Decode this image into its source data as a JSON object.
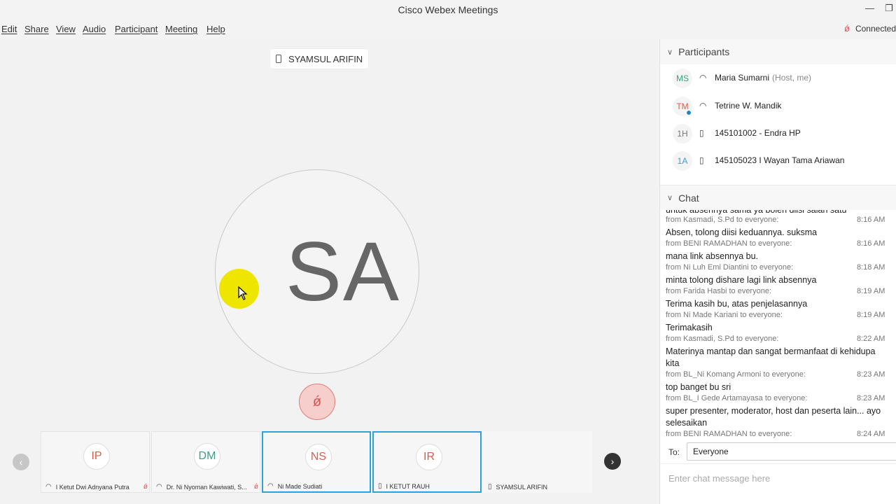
{
  "window": {
    "title": "Cisco Webex Meetings",
    "minimize_glyph": "—",
    "maximize_glyph": "❐"
  },
  "menu": [
    {
      "label": "Edit"
    },
    {
      "label": "Share"
    },
    {
      "label": "View"
    },
    {
      "label": "Audio"
    },
    {
      "label": "Participant"
    },
    {
      "label": "Meeting"
    },
    {
      "label": "Help"
    }
  ],
  "status": {
    "text": "Connected",
    "icon": "muted-mic-icon"
  },
  "stage": {
    "active_speaker": "SYAMSUL ARIFIN",
    "avatar_initials": "SA",
    "mute_icon": "muted-mic-icon"
  },
  "thumbnails": [
    {
      "initials": "IP",
      "color": "#e05a47",
      "name": "I Ketut Dwi Adnyana Putra",
      "icon": "headset-icon",
      "muted": true,
      "active": false
    },
    {
      "initials": "DM",
      "color": "#3aa27e",
      "name": "Dr. Ni Nyoman Kawiwati, S...",
      "icon": "headset-icon",
      "muted": true,
      "active": false
    },
    {
      "initials": "NS",
      "color": "#e05a47",
      "name": "Ni Made Sudiati",
      "icon": "headset-icon",
      "muted": false,
      "active": true
    },
    {
      "initials": "IR",
      "color": "#e05a47",
      "name": "I KETUT RAUH",
      "icon": "phone-icon",
      "muted": false,
      "active": true
    },
    {
      "initials": "",
      "color": "#999999",
      "name": "SYAMSUL ARIFIN",
      "icon": "phone-icon",
      "muted": false,
      "active": false
    }
  ],
  "nav": {
    "prev_glyph": "‹",
    "next_glyph": "›"
  },
  "participants": {
    "header": "Participants",
    "list": [
      {
        "initials": "MS",
        "color": "#3aa27e",
        "name": "Maria Sumarni",
        "role": "(Host, me)",
        "icon": "headset-icon"
      },
      {
        "initials": "TM",
        "color": "#e05a47",
        "name": "Tetrine W. Mandik",
        "role": "",
        "icon": "headset-icon"
      },
      {
        "initials": "1H",
        "color": "#777777",
        "name": "145101002 - Endra HP",
        "role": "",
        "icon": "phone-icon"
      },
      {
        "initials": "1A",
        "color": "#2ea1d6",
        "name": "145105023 I Wayan Tama Ariawan",
        "role": "",
        "icon": "phone-icon"
      }
    ]
  },
  "chat": {
    "header": "Chat",
    "partial_top": "untuk absennya sama ya boleh diisi salah satu",
    "messages": [
      {
        "from": "from Kasmadi, S.Pd to everyone:",
        "time": "8:16 AM",
        "text": "Absen, tolong diisi keduannya. suksma"
      },
      {
        "from": "from BENI RAMADHAN to everyone:",
        "time": "8:16 AM",
        "text": "mana link absennya bu."
      },
      {
        "from": "from Ni Luh Emi Diantini to everyone:",
        "time": "8:18 AM",
        "text": "minta tolong dishare lagi link absennya"
      },
      {
        "from": "from Farida Hasbi to everyone:",
        "time": "8:19 AM",
        "text": "Terima kasih bu, atas penjelasannya"
      },
      {
        "from": "from Ni Made Kariani to everyone:",
        "time": "8:19 AM",
        "text": "Terimakasih"
      },
      {
        "from": "from Kasmadi, S.Pd to everyone:",
        "time": "8:22 AM",
        "text": "Materinya mantap dan sangat bermanfaat di kehidupa",
        "text2": "kita"
      },
      {
        "from": "from BL_Ni Komang Armoni to everyone:",
        "time": "8:23 AM",
        "text": "top banget bu sri"
      },
      {
        "from": "from BL_I Gede Artamayasa to everyone:",
        "time": "8:23 AM",
        "text": "super presenter, moderator, host dan peserta lain... ayo",
        "text2": "selesaikan"
      },
      {
        "from": "from BENI RAMADHAN to everyone:",
        "time": "8:24 AM",
        "text": ""
      }
    ],
    "to_label": "To:",
    "to_value": "Everyone",
    "input_placeholder": "Enter chat message here"
  }
}
